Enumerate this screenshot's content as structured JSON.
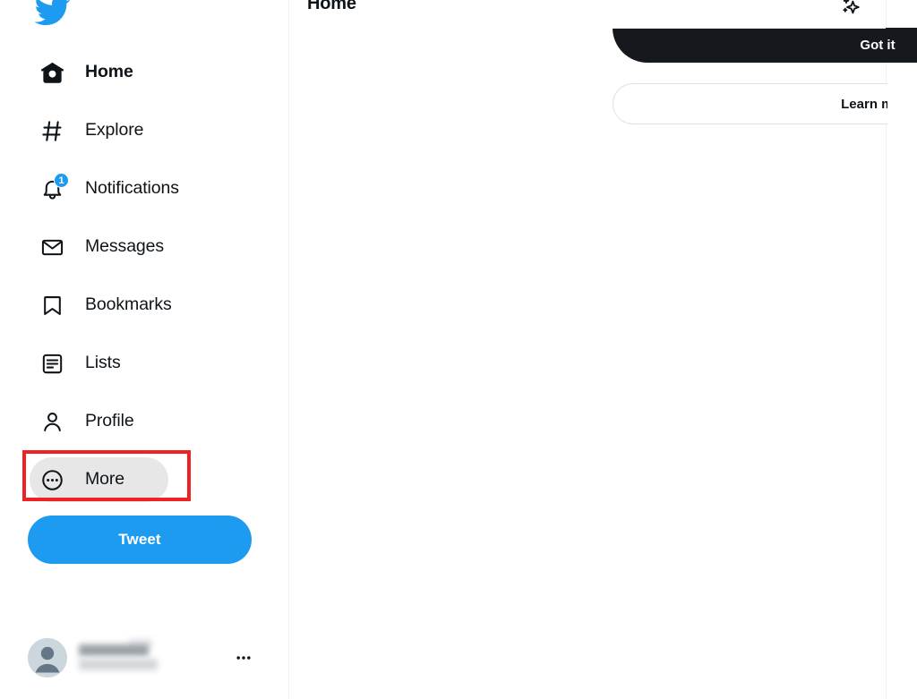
{
  "colors": {
    "brand_blue": "#1d9bf0",
    "text_primary": "#0f1419",
    "hover_pill": "#e7e7e8",
    "annotation_red": "#ee2222",
    "dark_button": "#15181c",
    "border": "#eff3f4"
  },
  "sidebar": {
    "logo": "twitter-bird-logo",
    "items": [
      {
        "label": "Home",
        "icon": "home-icon",
        "active": true,
        "hovered": false,
        "badge": null
      },
      {
        "label": "Explore",
        "icon": "hashtag-icon",
        "active": false,
        "hovered": false,
        "badge": null
      },
      {
        "label": "Notifications",
        "icon": "bell-icon",
        "active": false,
        "hovered": false,
        "badge": "1"
      },
      {
        "label": "Messages",
        "icon": "envelope-icon",
        "active": false,
        "hovered": false,
        "badge": null
      },
      {
        "label": "Bookmarks",
        "icon": "bookmark-icon",
        "active": false,
        "hovered": false,
        "badge": null
      },
      {
        "label": "Lists",
        "icon": "list-icon",
        "active": false,
        "hovered": false,
        "badge": null
      },
      {
        "label": "Profile",
        "icon": "person-icon",
        "active": false,
        "hovered": false,
        "badge": null
      },
      {
        "label": "More",
        "icon": "more-circle-icon",
        "active": false,
        "hovered": true,
        "badge": null
      }
    ],
    "tweet_button_label": "Tweet",
    "account": {
      "avatar": "default-avatar-icon",
      "display_name_redacted": true,
      "handle_redacted": true,
      "more_options_icon": "ellipsis-icon"
    }
  },
  "annotation": {
    "target": "More",
    "shape": "rectangle",
    "color": "#ee2222"
  },
  "main": {
    "header": {
      "title": "Home",
      "timeline_settings_icon": "sparkles-icon"
    },
    "prompt": {
      "primary_button_label": "Got it",
      "secondary_button_label": "Learn more"
    }
  }
}
